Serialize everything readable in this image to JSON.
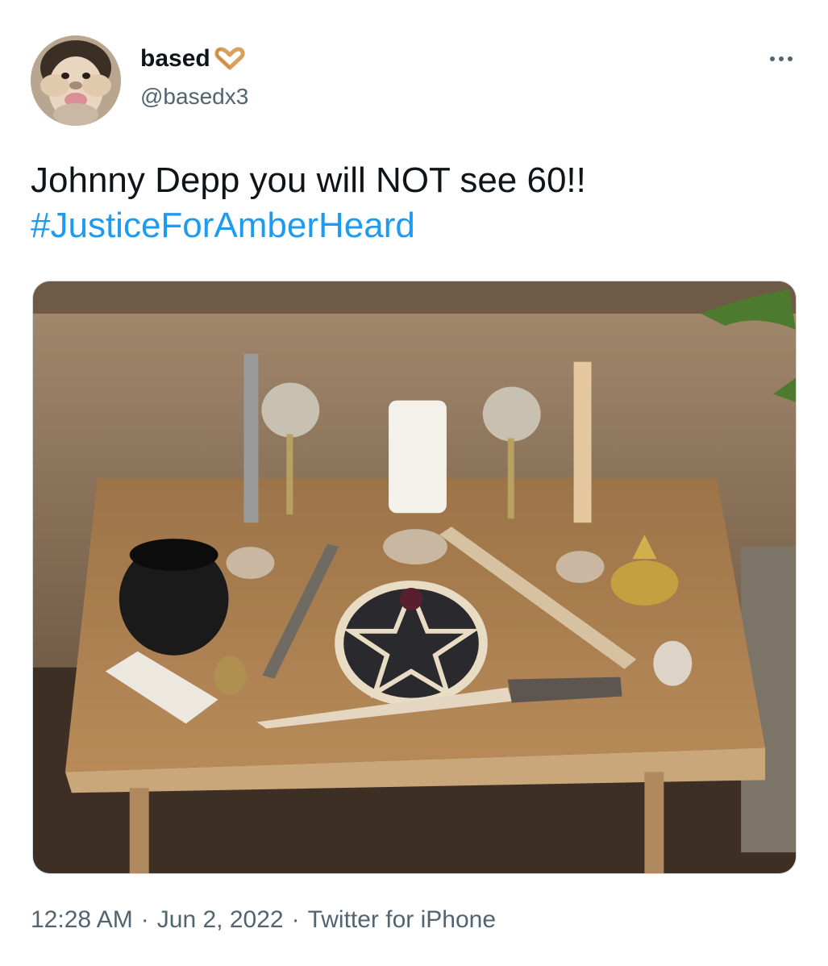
{
  "user": {
    "display_name": "based",
    "handle": "@basedx3",
    "name_emoji": "heart-hands-icon"
  },
  "tweet": {
    "text": "Johnny Depp you will NOT see 60!!",
    "hashtag": "#JusticeForAmberHeard"
  },
  "meta": {
    "time": "12:28 AM",
    "date": "Jun 2, 2022",
    "source": "Twitter for iPhone"
  },
  "colors": {
    "link": "#1d9bf0",
    "secondary_text": "#536471",
    "primary_text": "#0f1419"
  }
}
